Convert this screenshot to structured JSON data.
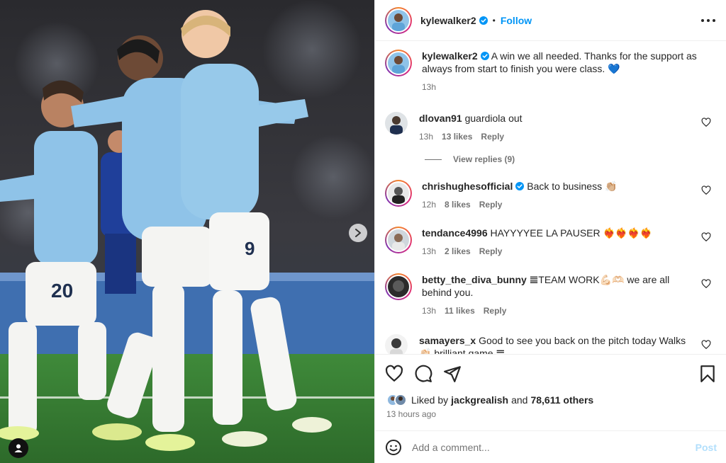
{
  "post": {
    "username": "kylewalker2",
    "follow_label": "Follow",
    "separator": "•"
  },
  "caption": {
    "username": "kylewalker2",
    "text": "A win we all needed. Thanks for the support as always from start to finish you were class. 💙",
    "time": "13h"
  },
  "comments": [
    {
      "username": "dlovan91",
      "verified": false,
      "text": "guardiola out",
      "time": "13h",
      "likes": "13 likes",
      "reply": "Reply"
    },
    {
      "username": "chrishughesofficial",
      "verified": true,
      "text": "Back to business 👏🏼",
      "time": "12h",
      "likes": "8 likes",
      "reply": "Reply"
    },
    {
      "username": "tendance4996",
      "verified": false,
      "text": "HAYYYYEE LA PAUSER ❤️‍🔥❤️‍🔥❤️‍🔥❤️‍🔥",
      "time": "13h",
      "likes": "2 likes",
      "reply": "Reply"
    },
    {
      "username": "betty_the_diva_bunny",
      "verified": false,
      "text": "𝌆TEAM WORK💪🏻🫶🏻 we are all behind you.",
      "time": "13h",
      "likes": "11 likes",
      "reply": "Reply"
    },
    {
      "username": "samayers_x",
      "verified": false,
      "text": "Good to see you back on the pitch today Walks 👏🏻 brilliant game 𝌆",
      "time": "",
      "likes": "",
      "reply": ""
    }
  ],
  "view_replies": "View replies (9)",
  "likes_bar": {
    "prefix": "Liked by",
    "user": "jackgrealish",
    "middle": "and",
    "count": "78,611 others"
  },
  "time_ago": "13 hours ago",
  "add_comment": {
    "placeholder": "Add a comment...",
    "post_label": "Post"
  },
  "icons": {
    "verified": "verified-badge-icon",
    "heart": "heart-icon",
    "comment": "comment-icon",
    "share": "share-icon",
    "save": "bookmark-icon",
    "emoji": "emoji-icon",
    "next": "chevron-right-icon",
    "tag": "user-tag-icon",
    "more": "more-options-icon"
  },
  "colors": {
    "link": "#0095f6",
    "verified": "#0095f6",
    "muted": "#737373",
    "post_disabled": "#b2dffc",
    "border": "#efefef"
  }
}
